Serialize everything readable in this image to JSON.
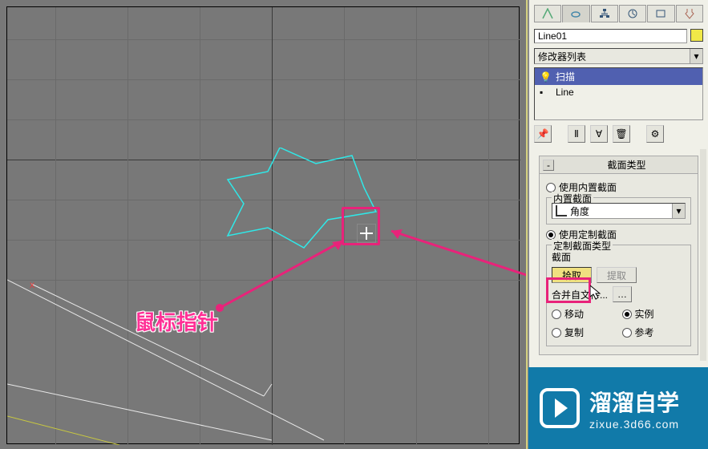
{
  "annotation": {
    "label": "鼠标指针"
  },
  "object_name": "Line01",
  "modifier_dropdown": "修改器列表",
  "stack": [
    {
      "icon": "💡",
      "label": "扫描"
    },
    {
      "icon": "➕",
      "label": "Line"
    }
  ],
  "rollup": {
    "title": "截面类型",
    "use_builtin": "使用内置截面",
    "builtin_group": "内置截面",
    "builtin_selected": "角度",
    "use_custom": "使用定制截面",
    "custom_group": "定制截面类型",
    "section_label": "截面",
    "pick": "拾取",
    "extract": "提取",
    "merge": "合并自文件...",
    "move": "移动",
    "instance": "实例",
    "copy": "复制",
    "reference": "参考"
  },
  "watermark": {
    "title": "溜溜自学",
    "url": "zixue.3d66.com"
  }
}
